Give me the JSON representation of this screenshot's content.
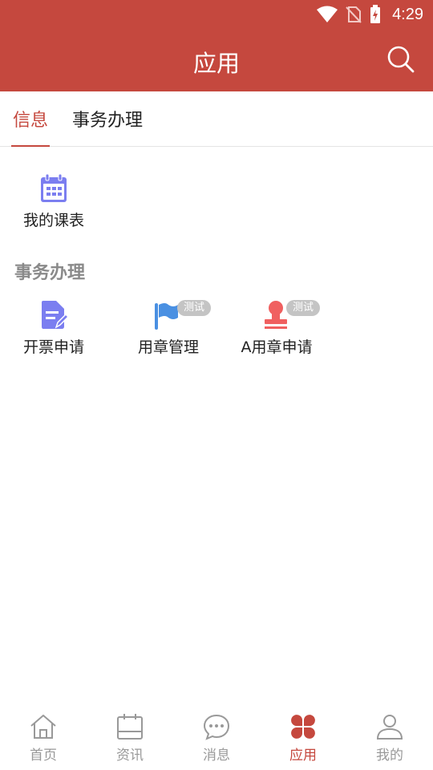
{
  "status": {
    "time": "4:29"
  },
  "appbar": {
    "title": "应用"
  },
  "tabs": [
    {
      "label": "信息"
    },
    {
      "label": "事务办理"
    }
  ],
  "info_section": {
    "items": [
      {
        "label": "我的课表",
        "icon": "calendar-icon"
      }
    ]
  },
  "affairs_section": {
    "title": "事务办理",
    "items": [
      {
        "label": "开票申请",
        "icon": "document-edit-icon",
        "badge": ""
      },
      {
        "label": "用章管理",
        "icon": "flag-icon",
        "badge": "测试"
      },
      {
        "label": "A用章申请",
        "icon": "stamp-icon",
        "badge": "测试"
      }
    ]
  },
  "bottom_nav": [
    {
      "label": "首页",
      "icon": "home-icon"
    },
    {
      "label": "资讯",
      "icon": "calendar-news-icon"
    },
    {
      "label": "消息",
      "icon": "chat-bubble-icon"
    },
    {
      "label": "应用",
      "icon": "clover-apps-icon",
      "active": true
    },
    {
      "label": "我的",
      "icon": "user-icon"
    }
  ],
  "colors": {
    "brand": "#c5483e",
    "inactive": "#999999",
    "badge": "#c4c4c4"
  }
}
